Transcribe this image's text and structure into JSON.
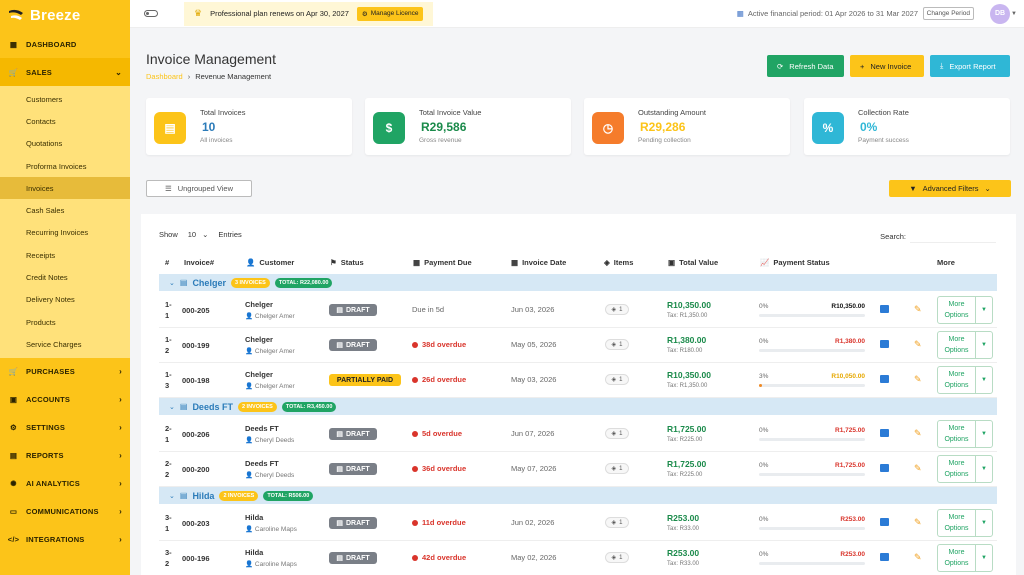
{
  "app": {
    "name": "Breeze"
  },
  "sidebar": {
    "top_items": [
      {
        "label": "DASHBOARD",
        "icon": "dashboard-icon"
      },
      {
        "label": "SALES",
        "icon": "cart-icon"
      }
    ],
    "sales_submenu": [
      "Customers",
      "Contacts",
      "Quotations",
      "Proforma Invoices",
      "Invoices",
      "Cash Sales",
      "Recurring Invoices",
      "Receipts",
      "Credit Notes",
      "Delivery Notes",
      "Products",
      "Service Charges"
    ],
    "active_submenu": "Invoices",
    "bottom_items": [
      {
        "label": "PURCHASES",
        "icon": "cart-icon"
      },
      {
        "label": "ACCOUNTS",
        "icon": "wallet-icon"
      },
      {
        "label": "SETTINGS",
        "icon": "gear-icon"
      },
      {
        "label": "REPORTS",
        "icon": "report-icon"
      },
      {
        "label": "AI ANALYTICS",
        "icon": "ai-icon"
      },
      {
        "label": "COMMUNICATIONS",
        "icon": "chat-icon"
      },
      {
        "label": "INTEGRATIONS",
        "icon": "code-icon"
      }
    ]
  },
  "topbar": {
    "plan_text": "Professional plan renews on Apr 30, 2027",
    "manage_label": "Manage Licence",
    "financial_period": "Active financial period: 01 Apr 2026 to 31 Mar 2027",
    "change_period_label": "Change Period",
    "avatar_initials": "DB"
  },
  "header": {
    "title": "Invoice Management",
    "breadcrumb_root": "Dashboard",
    "breadcrumb_current": "Revenue Management",
    "refresh_label": "Refresh Data",
    "new_label": "New Invoice",
    "export_label": "Export Report"
  },
  "stats": [
    {
      "label": "Total Invoices",
      "value": "10",
      "sub": "All invoices",
      "color": "#fcc419",
      "value_color": "#2b7bb9",
      "icon": "document-icon"
    },
    {
      "label": "Total Invoice Value",
      "value": "R29,586",
      "sub": "Gross revenue",
      "color": "#20a464",
      "value_color": "#1a8a4a",
      "icon": "dollar-icon"
    },
    {
      "label": "Outstanding Amount",
      "value": "R29,286",
      "sub": "Pending collection",
      "color": "#f57c2b",
      "value_color": "#fcc419",
      "icon": "clock-icon"
    },
    {
      "label": "Collection Rate",
      "value": "0%",
      "sub": "Payment success",
      "color": "#2fb7d6",
      "value_color": "#2fb7d6",
      "icon": "percent-icon"
    }
  ],
  "controls": {
    "ungrouped_label": "Ungrouped View",
    "advanced_filters_label": "Advanced Filters",
    "show_label": "Show",
    "entries_value": "10",
    "entries_label": "Entries",
    "search_label": "Search:"
  },
  "columns": [
    "#",
    "Invoice#",
    "Customer",
    "Status",
    "Payment Due",
    "Invoice Date",
    "Items",
    "Total Value",
    "Payment Status",
    "More"
  ],
  "groups": [
    {
      "name": "Chelger",
      "count_badge": "3 INVOICES",
      "total_badge": "TOTAL: R22,080.00",
      "rows": [
        {
          "num": "1-1",
          "invoice": "000-205",
          "customer": "Chelger",
          "contact": "Chelger Amer",
          "status": "DRAFT",
          "due": "Due in 5d",
          "due_overdue": false,
          "date": "Jun 03, 2026",
          "items": "1",
          "total": "R10,350.00",
          "tax": "Tax: R1,350.00",
          "pct": "0%",
          "amount": "R10,350.00",
          "amount_tone": "dark",
          "progress": 0,
          "more": "More Options"
        },
        {
          "num": "1-2",
          "invoice": "000-199",
          "customer": "Chelger",
          "contact": "Chelger Amer",
          "status": "DRAFT",
          "due": "38d overdue",
          "due_overdue": true,
          "date": "May 05, 2026",
          "items": "1",
          "total": "R1,380.00",
          "tax": "Tax: R180.00",
          "pct": "0%",
          "amount": "R1,380.00",
          "amount_tone": "red",
          "progress": 0,
          "more": "More Options"
        },
        {
          "num": "1-3",
          "invoice": "000-198",
          "customer": "Chelger",
          "contact": "Chelger Amer",
          "status": "PARTIALLY PAID",
          "due": "26d overdue",
          "due_overdue": true,
          "date": "May 03, 2026",
          "items": "1",
          "total": "R10,350.00",
          "tax": "Tax: R1,350.00",
          "pct": "3%",
          "amount": "R10,050.00",
          "amount_tone": "yellow",
          "progress": 0.03,
          "more": "More Options"
        }
      ]
    },
    {
      "name": "Deeds FT",
      "count_badge": "2 INVOICES",
      "total_badge": "TOTAL: R3,450.00",
      "rows": [
        {
          "num": "2-1",
          "invoice": "000-206",
          "customer": "Deeds FT",
          "contact": "Cheryl Deeds",
          "status": "DRAFT",
          "due": "5d overdue",
          "due_overdue": true,
          "date": "Jun 07, 2026",
          "items": "1",
          "total": "R1,725.00",
          "tax": "Tax: R225.00",
          "pct": "0%",
          "amount": "R1,725.00",
          "amount_tone": "red",
          "progress": 0,
          "more": "More Options"
        },
        {
          "num": "2-2",
          "invoice": "000-200",
          "customer": "Deeds FT",
          "contact": "Cheryl Deeds",
          "status": "DRAFT",
          "due": "36d overdue",
          "due_overdue": true,
          "date": "May 07, 2026",
          "items": "1",
          "total": "R1,725.00",
          "tax": "Tax: R225.00",
          "pct": "0%",
          "amount": "R1,725.00",
          "amount_tone": "red",
          "progress": 0,
          "more": "More Options"
        }
      ]
    },
    {
      "name": "Hilda",
      "count_badge": "2 INVOICES",
      "total_badge": "TOTAL: R506.00",
      "rows": [
        {
          "num": "3-1",
          "invoice": "000-203",
          "customer": "Hilda",
          "contact": "Caroline Maps",
          "status": "DRAFT",
          "due": "11d overdue",
          "due_overdue": true,
          "date": "Jun 02, 2026",
          "items": "1",
          "total": "R253.00",
          "tax": "Tax: R33.00",
          "pct": "0%",
          "amount": "R253.00",
          "amount_tone": "red",
          "progress": 0,
          "more": "More Options"
        },
        {
          "num": "3-2",
          "invoice": "000-196",
          "customer": "Hilda",
          "contact": "Caroline Maps",
          "status": "DRAFT",
          "due": "42d overdue",
          "due_overdue": true,
          "date": "May 02, 2026",
          "items": "1",
          "total": "R253.00",
          "tax": "Tax: R33.00",
          "pct": "0%",
          "amount": "R253.00",
          "amount_tone": "red",
          "progress": 0,
          "more": "More Options"
        }
      ]
    }
  ]
}
